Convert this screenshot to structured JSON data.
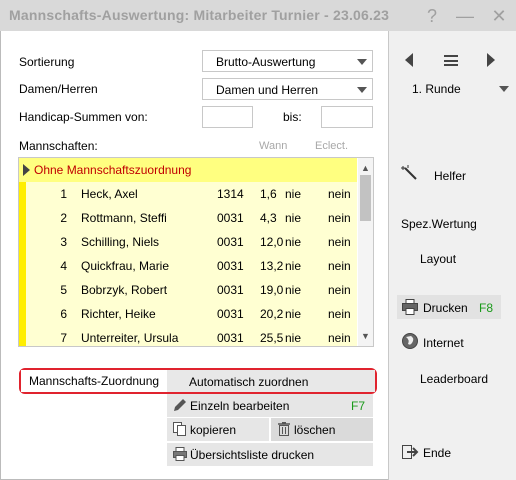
{
  "window": {
    "title": "Mannschafts-Auswertung: Mitarbeiter Turnier - 23.06.23",
    "help_glyph": "?",
    "minimize_glyph": "—",
    "close_glyph": "✕"
  },
  "form": {
    "sort_label": "Sortierung",
    "sort_value": "Brutto-Auswertung",
    "gender_label": "Damen/Herren",
    "gender_value": "Damen und Herren",
    "hcp_label": "Handicap-Summen von:",
    "hcp_to_label": "bis:",
    "teams_label": "Mannschaften:",
    "col_wann": "Wann",
    "col_eclect": "Eclect."
  },
  "teams": {
    "group_label": "Ohne Mannschaftszuordnung",
    "rows": [
      {
        "no": "1",
        "name": "Heck, Axel",
        "code": "1314",
        "hcp": "1,6",
        "wann": "nie",
        "eclect": "nein"
      },
      {
        "no": "2",
        "name": "Rottmann, Steffi",
        "code": "0031",
        "hcp": "4,3",
        "wann": "nie",
        "eclect": "nein"
      },
      {
        "no": "3",
        "name": "Schilling, Niels",
        "code": "0031",
        "hcp": "12,0",
        "wann": "nie",
        "eclect": "nein"
      },
      {
        "no": "4",
        "name": "Quickfrau, Marie",
        "code": "0031",
        "hcp": "13,2",
        "wann": "nie",
        "eclect": "nein"
      },
      {
        "no": "5",
        "name": "Bobrzyk, Robert",
        "code": "0031",
        "hcp": "19,0",
        "wann": "nie",
        "eclect": "nein"
      },
      {
        "no": "6",
        "name": "Richter, Heike",
        "code": "0031",
        "hcp": "20,2",
        "wann": "nie",
        "eclect": "nein"
      },
      {
        "no": "7",
        "name": "Unterreiter, Ursula",
        "code": "0031",
        "hcp": "25,5",
        "wann": "nie",
        "eclect": "nein"
      }
    ]
  },
  "tabs": {
    "active": "Mannschafts-Zuordnung",
    "other": "Automatisch zuordnen"
  },
  "actions": {
    "edit_label": "Einzeln bearbeiten",
    "edit_hotkey": "F7",
    "copy_label": "kopieren",
    "delete_label": "löschen",
    "print_list_label": "Übersichtsliste drucken"
  },
  "right_panel": {
    "round_value": "1. Runde",
    "helper": "Helfer",
    "spez_wertung": "Spez.Wertung",
    "layout": "Layout",
    "print": "Drucken",
    "print_hotkey": "F8",
    "internet": "Internet",
    "leaderboard": "Leaderboard",
    "end": "Ende"
  },
  "colors": {
    "group_bg": "#ffff80",
    "row_bg": "#ffffd2",
    "group_text": "#c00000",
    "highlight_border": "#e0232e",
    "hotkey": "#1a9a1a"
  }
}
